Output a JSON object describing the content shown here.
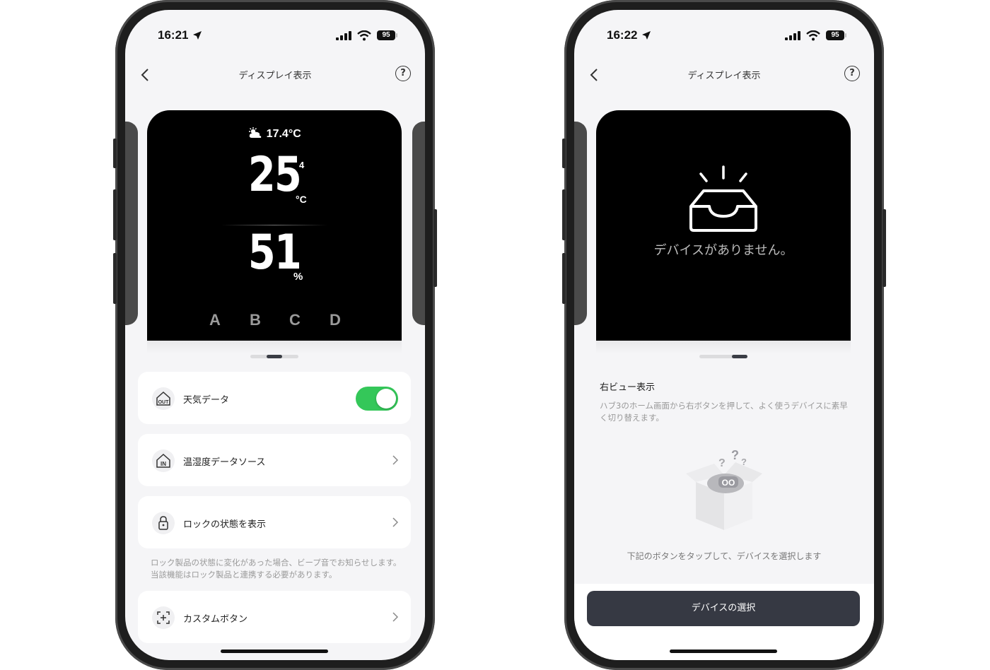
{
  "left_phone": {
    "status": {
      "time": "16:21",
      "battery": "95"
    },
    "nav": {
      "title": "ディスプレイ表示",
      "help": "?"
    },
    "display": {
      "outdoor_temp": "17.4°C",
      "temperature": "25",
      "temperature_decimal": "4",
      "temperature_unit": "°C",
      "humidity": "51",
      "humidity_unit": "%",
      "buttons": [
        "A",
        "B",
        "C",
        "D"
      ]
    },
    "settings": [
      {
        "label": "天気データ",
        "icon": "house-out-icon",
        "control": "toggle",
        "enabled": true
      },
      {
        "label": "温湿度データソース",
        "icon": "house-in-icon",
        "control": "chevron"
      },
      {
        "label": "ロックの状態を表示",
        "icon": "lock-icon",
        "control": "chevron"
      },
      {
        "label": "カスタムボタン",
        "icon": "custom-button-icon",
        "control": "chevron"
      }
    ],
    "lock_note": "ロック製品の状態に変化があった場合、ビープ音でお知らせします。当該機能はロック製品と連携する必要があります。"
  },
  "right_phone": {
    "status": {
      "time": "16:22",
      "battery": "95"
    },
    "nav": {
      "title": "ディスプレイ表示",
      "help": "?"
    },
    "display": {
      "empty_message": "デバイスがありません。"
    },
    "section": {
      "title": "右ビュー表示",
      "description": "ハブ3のホーム画面から右ボタンを押して、よく使うデバイスに素早く切り替えます。"
    },
    "tap_hint": "下記のボタンをタップして、デバイスを選択します",
    "cta_label": "デバイスの選択"
  },
  "colors": {
    "accent_green": "#34c759",
    "button_dark": "#363943"
  }
}
